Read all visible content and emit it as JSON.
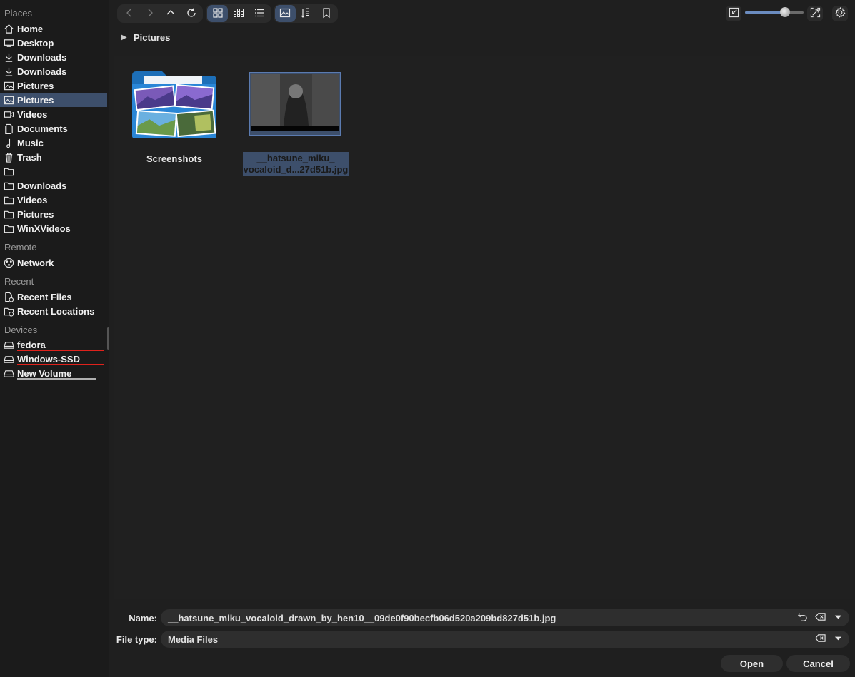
{
  "sidebar": {
    "places_title": "Places",
    "places": [
      {
        "label": "Home",
        "icon": "home-icon"
      },
      {
        "label": "Desktop",
        "icon": "desktop-icon"
      },
      {
        "label": "Downloads",
        "icon": "download-icon"
      },
      {
        "label": "Downloads",
        "icon": "download-icon"
      },
      {
        "label": "Pictures",
        "icon": "picture-icon"
      },
      {
        "label": "Pictures",
        "icon": "picture-icon",
        "selected": true
      },
      {
        "label": "Videos",
        "icon": "video-icon"
      },
      {
        "label": "Documents",
        "icon": "document-icon"
      },
      {
        "label": "Music",
        "icon": "music-icon"
      },
      {
        "label": "Trash",
        "icon": "trash-icon"
      },
      {
        "label": "",
        "icon": "folder-icon"
      },
      {
        "label": "Downloads",
        "icon": "folder-icon"
      },
      {
        "label": "Videos",
        "icon": "folder-icon"
      },
      {
        "label": "Pictures",
        "icon": "folder-icon"
      },
      {
        "label": "WinXVideos",
        "icon": "folder-icon"
      }
    ],
    "remote_title": "Remote",
    "remote": [
      {
        "label": "Network",
        "icon": "network-icon"
      }
    ],
    "recent_title": "Recent",
    "recent": [
      {
        "label": "Recent Files",
        "icon": "recent-files-icon"
      },
      {
        "label": "Recent Locations",
        "icon": "recent-locations-icon"
      }
    ],
    "devices_title": "Devices",
    "devices": [
      {
        "label": "fedora",
        "icon": "drive-icon",
        "usage_color": "#e0221c"
      },
      {
        "label": "Windows-SSD",
        "icon": "drive-icon",
        "usage_color": "#e0221c"
      },
      {
        "label": "New Volume",
        "icon": "drive-icon",
        "usage_color": "#b0b0b0"
      }
    ]
  },
  "toolbar": {
    "nav": [
      "back-icon",
      "forward-icon",
      "up-icon",
      "reload-icon"
    ],
    "view_modes": [
      "icon-view-icon",
      "compact-view-icon",
      "detail-view-icon"
    ],
    "options": [
      "preview-icon",
      "sort-icon",
      "bookmark-icon"
    ],
    "zoom_fraction": 0.69
  },
  "pathbar": {
    "current": "Pictures"
  },
  "files": [
    {
      "name": "Screenshots",
      "type": "folder"
    },
    {
      "name_line1": "__hatsune_miku_",
      "name_line2": "vocaloid_d...27d51b.jpg",
      "type": "image",
      "selected": true
    }
  ],
  "form": {
    "name_label": "Name:",
    "name_value": "__hatsune_miku_vocaloid_drawn_by_hen10__09de0f90becfb06d520a209bd827d51b.jpg",
    "type_label": "File type:",
    "type_value": "Media Files",
    "open_label": "Open",
    "cancel_label": "Cancel"
  },
  "colors": {
    "accent": "#3d4f6b",
    "background": "#1f1f1f",
    "device_bar_red": "#e0221c"
  }
}
